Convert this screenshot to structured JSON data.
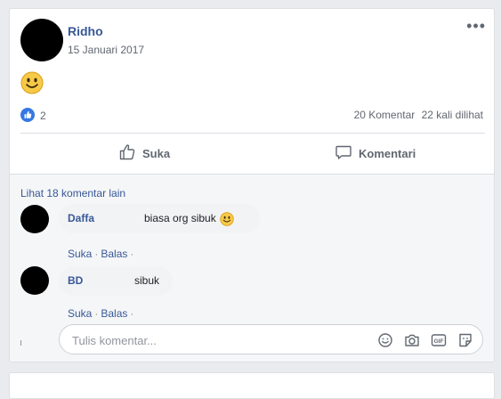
{
  "post": {
    "author": "Ridho",
    "date": "15 Januari 2017",
    "content_emoji": "smiley-emoji",
    "likes": "2",
    "comments_count": "20 Komentar",
    "views": "22 kali dilihat"
  },
  "actions": {
    "like_label": "Suka",
    "comment_label": "Komentari"
  },
  "comments": {
    "more_link": "Lihat 18 komentar lain",
    "items": [
      {
        "name": "Daffa",
        "text": "biasa org sibuk",
        "like": "Suka",
        "reply": "Balas",
        "dot": "·"
      },
      {
        "name": "BD",
        "text": "sibuk",
        "like": "Suka",
        "reply": "Balas",
        "dot": "·"
      }
    ]
  },
  "composer": {
    "placeholder": "Tulis komentar...",
    "icons": [
      "emoji-icon",
      "camera-icon",
      "gif-icon",
      "sticker-icon"
    ]
  },
  "colors": {
    "link": "#385898",
    "like_blue": "#3578e5",
    "background": "#e9ebee"
  }
}
